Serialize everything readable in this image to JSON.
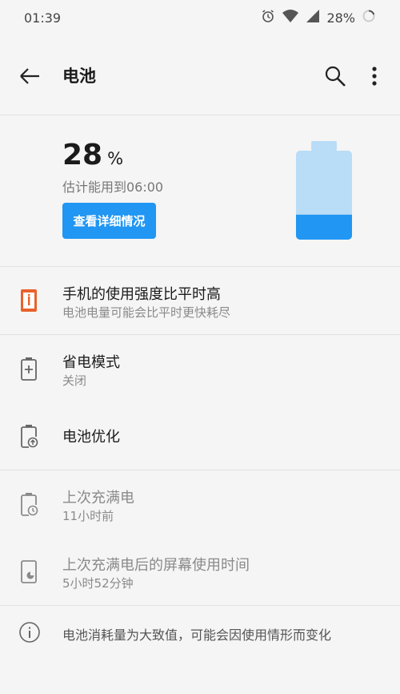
{
  "status": {
    "time": "01:39",
    "battery": "28%"
  },
  "appbar": {
    "title": "电池"
  },
  "hero": {
    "percent": "28",
    "percent_sign": "%",
    "estimate": "估计能用到06:00",
    "detail_button": "查看详细情况",
    "battery_level": 0.28
  },
  "rows": [
    {
      "title": "手机的使用强度比平时高",
      "subtitle": "电池电量可能会比平时更快耗尽"
    },
    {
      "title": "省电模式",
      "subtitle": "关闭"
    },
    {
      "title": "电池优化"
    },
    {
      "title": "上次充满电",
      "subtitle": "11小时前"
    },
    {
      "title": "上次充满电后的屏幕使用时间",
      "subtitle": "5小时52分钟"
    }
  ],
  "footer": {
    "note": "电池消耗量为大致值，可能会因使用情形而变化"
  },
  "colors": {
    "accent": "#2196f3",
    "battery_light": "#b9dcf7",
    "warning": "#e8622c"
  }
}
